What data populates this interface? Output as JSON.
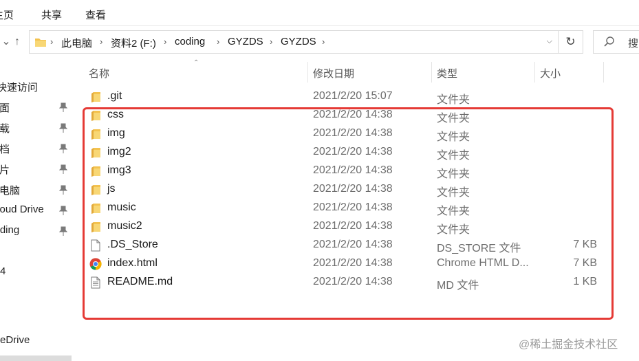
{
  "ribbon": {
    "tabs": [
      "主页",
      "共享",
      "查看"
    ]
  },
  "address": {
    "crumbs": [
      "此电脑",
      "资料2 (F:)",
      "coding",
      "GYZDS",
      "GYZDS"
    ],
    "search_text": "搜"
  },
  "nav": {
    "items": [
      {
        "label": "快速访问",
        "pinned": false
      },
      {
        "label": "桌面",
        "pinned": true
      },
      {
        "label": "下载",
        "pinned": true
      },
      {
        "label": "文档",
        "pinned": true
      },
      {
        "label": "图片",
        "pinned": true
      },
      {
        "label": "此电脑",
        "pinned": true
      },
      {
        "label": "iCloud Drive",
        "pinned": true
      },
      {
        "label": "coding",
        "pinned": true
      },
      {
        "label": "",
        "pinned": false
      },
      {
        "label": "4",
        "pinned": false
      },
      {
        "label": "",
        "pinned": false
      },
      {
        "label": "",
        "pinned": false
      },
      {
        "label": "",
        "pinned": false
      },
      {
        "label": "OneDrive",
        "pinned": false
      }
    ]
  },
  "columns": {
    "name": "名称",
    "date": "修改日期",
    "type": "类型",
    "size": "大小"
  },
  "files": [
    {
      "name": ".git",
      "date": "2021/2/20 15:07",
      "type": "文件夹",
      "size": "",
      "icon": "folder-icon"
    },
    {
      "name": "css",
      "date": "2021/2/20 14:38",
      "type": "文件夹",
      "size": "",
      "icon": "folder-icon"
    },
    {
      "name": "img",
      "date": "2021/2/20 14:38",
      "type": "文件夹",
      "size": "",
      "icon": "folder-icon"
    },
    {
      "name": "img2",
      "date": "2021/2/20 14:38",
      "type": "文件夹",
      "size": "",
      "icon": "folder-icon"
    },
    {
      "name": "img3",
      "date": "2021/2/20 14:38",
      "type": "文件夹",
      "size": "",
      "icon": "folder-icon"
    },
    {
      "name": "js",
      "date": "2021/2/20 14:38",
      "type": "文件夹",
      "size": "",
      "icon": "folder-icon"
    },
    {
      "name": "music",
      "date": "2021/2/20 14:38",
      "type": "文件夹",
      "size": "",
      "icon": "folder-icon"
    },
    {
      "name": "music2",
      "date": "2021/2/20 14:38",
      "type": "文件夹",
      "size": "",
      "icon": "folder-icon"
    },
    {
      "name": ".DS_Store",
      "date": "2021/2/20 14:38",
      "type": "DS_STORE 文件",
      "size": "7 KB",
      "icon": "file-icon"
    },
    {
      "name": "index.html",
      "date": "2021/2/20 14:38",
      "type": "Chrome HTML D...",
      "size": "7 KB",
      "icon": "chrome-icon"
    },
    {
      "name": "README.md",
      "date": "2021/2/20 14:38",
      "type": "MD 文件",
      "size": "1 KB",
      "icon": "text-file-icon"
    }
  ],
  "watermark": "@稀土掘金技术社区",
  "colors": {
    "highlight": "#e53a35",
    "folder": "#f3c24f"
  }
}
